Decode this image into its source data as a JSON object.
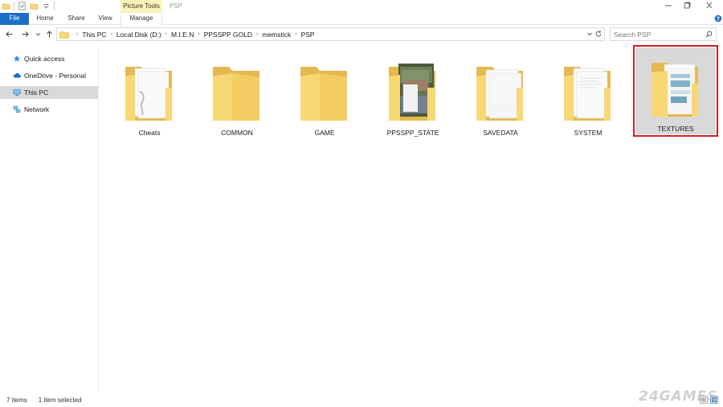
{
  "window": {
    "title": "PSP",
    "context_tab": "Picture Tools"
  },
  "ribbon": {
    "tabs": [
      {
        "label": "File"
      },
      {
        "label": "Home"
      },
      {
        "label": "Share"
      },
      {
        "label": "View"
      },
      {
        "label": "Manage"
      }
    ]
  },
  "address": {
    "crumbs": [
      "This PC",
      "Local Disk (D:)",
      "M.I.E.N",
      "PPSSPP GOLD",
      "memstick",
      "PSP"
    ]
  },
  "search": {
    "placeholder": "Search PSP"
  },
  "sidebar": {
    "items": [
      {
        "label": "Quick access",
        "icon": "star-icon"
      },
      {
        "label": "OneDrive - Personal",
        "icon": "cloud-icon"
      },
      {
        "label": "This PC",
        "icon": "computer-icon"
      },
      {
        "label": "Network",
        "icon": "network-icon"
      }
    ],
    "selected": "This PC"
  },
  "folders": [
    {
      "name": "Cheats",
      "icon": "folder-with-files-icon"
    },
    {
      "name": "COMMON",
      "icon": "folder-icon"
    },
    {
      "name": "GAME",
      "icon": "folder-icon"
    },
    {
      "name": "PPSSPP_STATE",
      "icon": "folder-with-images-icon"
    },
    {
      "name": "SAVEDATA",
      "icon": "folder-with-files-icon"
    },
    {
      "name": "SYSTEM",
      "icon": "folder-with-files-icon"
    },
    {
      "name": "TEXTURES",
      "icon": "folder-with-images-icon",
      "selected": true
    }
  ],
  "status": {
    "item_count": "7 items",
    "selection": "1 item selected"
  },
  "watermark": "24GAMES",
  "colors": {
    "file_tab": "#1a6ec8",
    "context_tab": "#fbf4b8",
    "selection_highlight": "#d9d9d9",
    "selection_outline": "#cf1f23",
    "folder_yellow": "#f8d775"
  }
}
